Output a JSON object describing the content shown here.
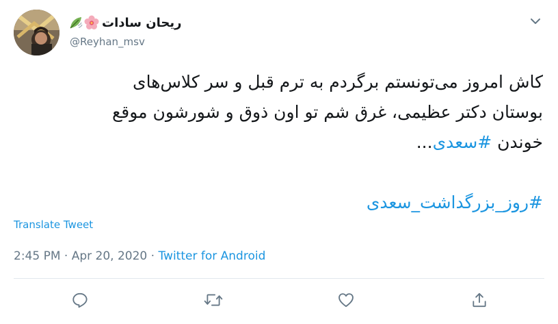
{
  "user": {
    "display_name": "ریحان سادات",
    "handle": "@Reyhan_msv",
    "avatar_icon": "avatar-photo",
    "name_emojis": [
      "leaf-fluttering-icon",
      "cherry-blossom-icon"
    ]
  },
  "tweet": {
    "line1": "کاش امروز می‌تونستم برگردم به ترم قبل و سر کلاس‌های",
    "line2": "بوستان دکتر عظیمی، غرق شم تو اون ذوق و شورشون موقع",
    "line3_text": "خوندن ",
    "line3_hashtag": "#سعدی",
    "line3_suffix": "...",
    "hashtag_line": "#روز_بزرگداشت_سعدی"
  },
  "translate_label": "Translate Tweet",
  "meta": {
    "time": "2:45 PM",
    "separator1": " · ",
    "date": "Apr 20, 2020",
    "separator2": " · ",
    "source": "Twitter for Android"
  },
  "colors": {
    "link": "#1b95e0",
    "text": "#14171a",
    "muted": "#657786",
    "divider": "#e1e8ed"
  },
  "actions": [
    "reply-icon",
    "retweet-icon",
    "like-icon",
    "share-icon"
  ]
}
